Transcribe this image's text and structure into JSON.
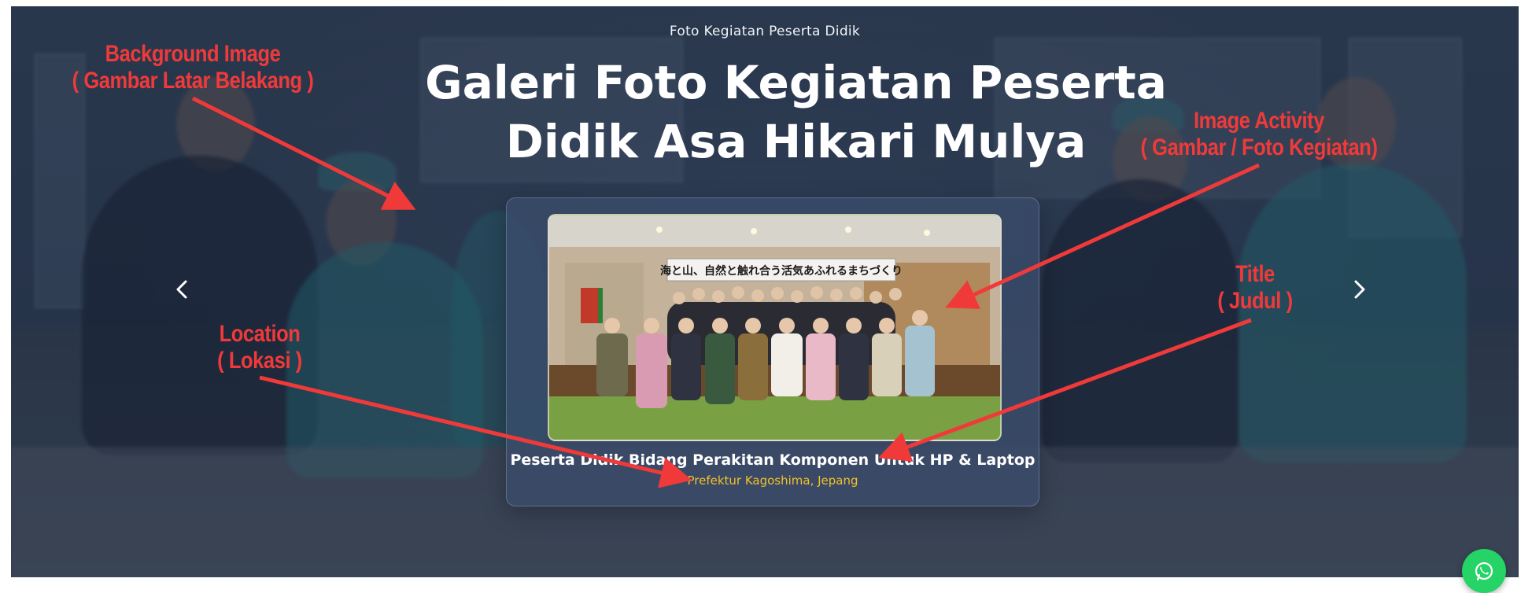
{
  "hero": {
    "kicker": "Foto Kegiatan Peserta Didik",
    "title": "Galeri Foto Kegiatan Peserta Didik Asa Hikari Mulya"
  },
  "carousel": {
    "prev_icon": "chevron-left-icon",
    "next_icon": "chevron-right-icon",
    "slide": {
      "banner_text": "海と山、自然と触れ合う活気あふれるまちづくり",
      "title": "Peserta Didik Bidang Perakitan Komponen Untuk HP & Laptop",
      "location": "Prefektur Kagoshima, Jepang"
    }
  },
  "annotations": {
    "background": [
      "Background Image",
      "( Gambar Latar Belakang )"
    ],
    "image": [
      "Image Activity",
      "( Gambar / Foto Kegiatan)"
    ],
    "title": [
      "Title",
      "( Judul )"
    ],
    "location": [
      "Location",
      "( Lokasi )"
    ]
  },
  "whatsapp": {
    "icon": "whatsapp-icon"
  },
  "colors": {
    "annotation_red": "#f03a3a",
    "location_yellow": "#f3c02a",
    "whatsapp_green": "#25d366"
  }
}
